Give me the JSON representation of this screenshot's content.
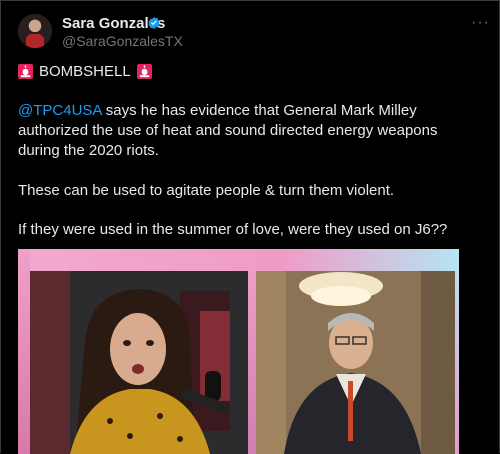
{
  "tweet": {
    "author_name": "Sara Gonzales",
    "author_handle": "@SaraGonzalesTX",
    "more_label": "···",
    "headline": "BOMBSHELL",
    "mention": "@TPC4USA",
    "paragraph1_rest": " says he has evidence that General Mark Milley authorized the use of heat and sound directed energy weapons during the 2020 riots.",
    "paragraph2": "These can be used to agitate people & turn them violent.",
    "paragraph3": "If they were used in the summer of love, were they used on J6??"
  },
  "colors": {
    "background": "#000000",
    "text": "#e7e9ea",
    "muted": "#71767b",
    "accent": "#1d9bf0",
    "siren": "#e0245e"
  },
  "icons": [
    "verified-badge-icon",
    "police-siren-icon",
    "more-icon"
  ]
}
